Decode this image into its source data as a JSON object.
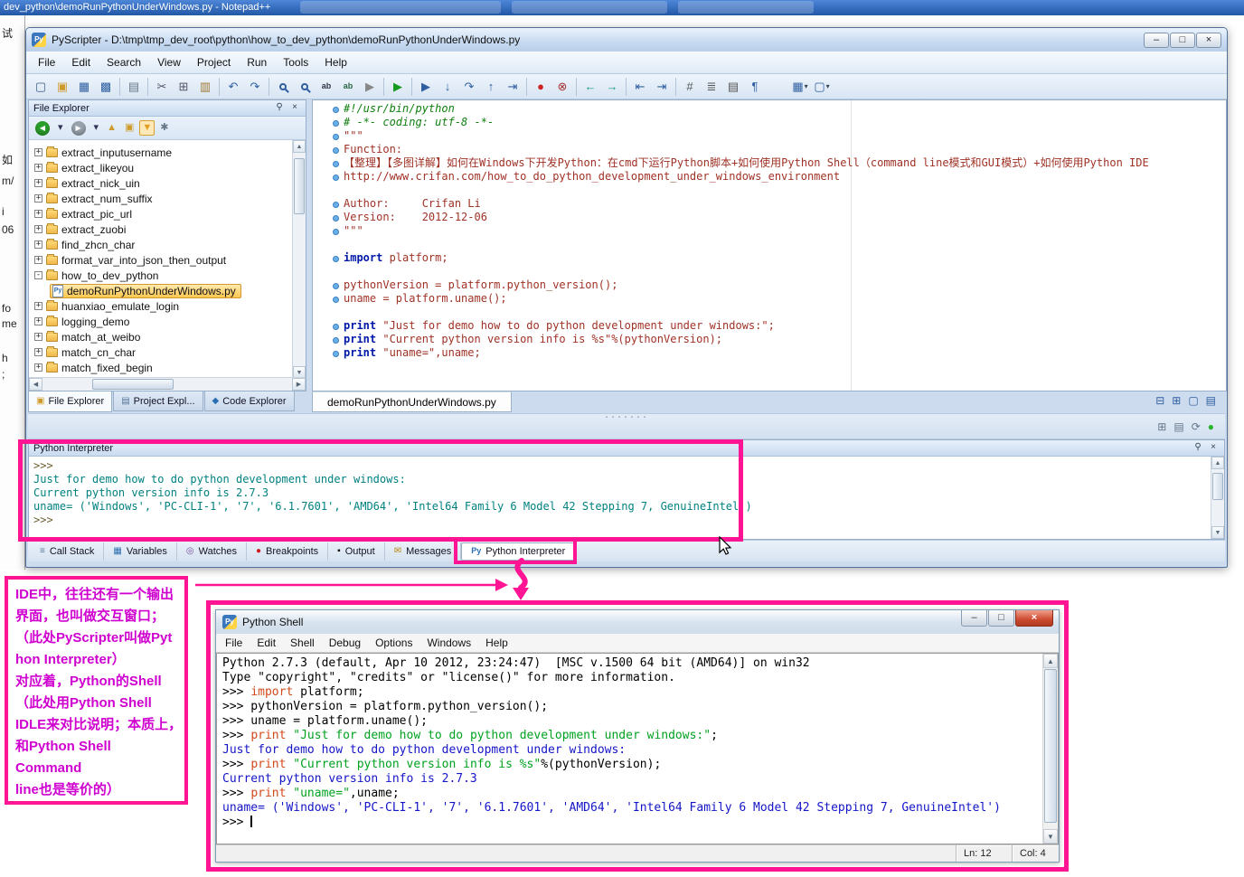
{
  "background": {
    "notepadpp_title": "dev_python\\demoRunPythonUnderWindows.py - Notepad++",
    "left_fragments": [
      "试",
      "如",
      "m/",
      "i",
      "06",
      "fo",
      "me",
      "h",
      ";"
    ]
  },
  "icons": {
    "pin": "⚲",
    "close": "×",
    "minimize": "–",
    "maximize": "□",
    "up": "▲",
    "down": "▼",
    "left": "◀",
    "right": "▶",
    "dropdown": "▾",
    "grip": "·······",
    "pyfile_glyph": "Py",
    "app_glyph": "Py"
  },
  "pyscripter": {
    "title": "PyScripter - D:\\tmp\\tmp_dev_root\\python\\how_to_dev_python\\demoRunPythonUnderWindows.py",
    "menu": [
      "File",
      "Edit",
      "Search",
      "View",
      "Project",
      "Run",
      "Tools",
      "Help"
    ],
    "toolbar": [
      {
        "n": "new-file-icon",
        "g": "▢",
        "c": "#3a5a80"
      },
      {
        "n": "open-file-icon",
        "g": "▣",
        "c": "#cf9a2c"
      },
      {
        "n": "save-icon",
        "g": "▦",
        "c": "#2f5fa0"
      },
      {
        "n": "save-all-icon",
        "g": "▩",
        "c": "#2f5fa0"
      },
      {
        "sep": true
      },
      {
        "n": "print-icon",
        "g": "▤",
        "c": "#667788"
      },
      {
        "sep": true
      },
      {
        "n": "cut-icon",
        "g": "✂",
        "c": "#556"
      },
      {
        "n": "copy-icon",
        "g": "⊞",
        "c": "#556"
      },
      {
        "n": "paste-icon",
        "g": "▥",
        "c": "#a07830"
      },
      {
        "sep": true
      },
      {
        "n": "undo-icon",
        "g": "↶",
        "c": "#2f5fa0"
      },
      {
        "n": "redo-icon",
        "g": "↷",
        "c": "#2f5fa0"
      },
      {
        "sep": true
      },
      {
        "n": "find-icon",
        "mag": true
      },
      {
        "n": "find-next-icon",
        "mag": true
      },
      {
        "n": "find-in-files-icon",
        "g": "ab",
        "c": "#334",
        "small": true
      },
      {
        "n": "replace-icon",
        "g": "ab",
        "c": "#286643",
        "small": true
      },
      {
        "n": "run-script-external-icon",
        "g": "▶",
        "c": "#888"
      },
      {
        "sep": true
      },
      {
        "n": "run-icon",
        "g": "▶",
        "c": "#18991f"
      },
      {
        "sep": true
      },
      {
        "n": "debug-icon",
        "g": "▶",
        "c": "#2f5fa0"
      },
      {
        "n": "step-into-icon",
        "g": "↓",
        "c": "#2f5fa0"
      },
      {
        "n": "step-over-icon",
        "g": "↷",
        "c": "#2f5fa0"
      },
      {
        "n": "step-out-icon",
        "g": "↑",
        "c": "#2f5fa0"
      },
      {
        "n": "run-to-cursor-icon",
        "g": "⇥",
        "c": "#2f5fa0"
      },
      {
        "sep": true
      },
      {
        "n": "stop-icon",
        "g": "●",
        "c": "#cc2222"
      },
      {
        "n": "detach-debugger-icon",
        "g": "⊗",
        "c": "#aa3333"
      },
      {
        "sep": true
      },
      {
        "n": "browse-back-icon",
        "g": "←",
        "c": "#1a9988"
      },
      {
        "n": "browse-forward-icon",
        "g": "→",
        "c": "#1a9988"
      },
      {
        "sep": true
      },
      {
        "n": "unindent-icon",
        "g": "⇤",
        "c": "#2f5fa0"
      },
      {
        "n": "indent-icon",
        "g": "⇥",
        "c": "#2f5fa0"
      },
      {
        "sep": true
      },
      {
        "n": "line-numbers-icon",
        "g": "#",
        "c": "#555"
      },
      {
        "n": "sorted-list-icon",
        "g": "≣",
        "c": "#555"
      },
      {
        "n": "doc-map-icon",
        "g": "▤",
        "c": "#555"
      },
      {
        "n": "special-chars-icon",
        "g": "¶",
        "c": "#2f5fa0"
      },
      {
        "gap": true
      },
      {
        "n": "editor-views-icon",
        "g": "▦",
        "c": "#2f5fa0",
        "dd": true
      },
      {
        "n": "layouts-icon",
        "g": "▢",
        "c": "#2f5fa0",
        "dd": true
      }
    ],
    "file_explorer": {
      "header": "File Explorer",
      "toolbar": [
        {
          "n": "back-icon",
          "g": "◀",
          "circle": "#2ba02b"
        },
        {
          "n": "back-history-dropdown",
          "g": "▾",
          "c": "#335"
        },
        {
          "n": "forward-icon",
          "g": "▶",
          "circle": "#9aa4ae"
        },
        {
          "n": "forward-history-dropdown",
          "g": "▾",
          "c": "#335"
        },
        {
          "n": "folder-up-icon",
          "g": "▲",
          "c": "#cf9a2c"
        },
        {
          "n": "new-folder-icon",
          "g": "▣",
          "c": "#cf9a2c"
        },
        {
          "n": "filter-icon",
          "g": "▼",
          "c": "#e0a020",
          "active": true
        },
        {
          "n": "folder-settings-icon",
          "g": "✱",
          "c": "#667788"
        }
      ],
      "tree": [
        {
          "label": "extract_inputusername",
          "expand": "+",
          "icon": "folder",
          "indent": 0
        },
        {
          "label": "extract_likeyou",
          "expand": "+",
          "icon": "folder",
          "indent": 0
        },
        {
          "label": "extract_nick_uin",
          "expand": "+",
          "icon": "folder",
          "indent": 0
        },
        {
          "label": "extract_num_suffix",
          "expand": "+",
          "icon": "folder",
          "indent": 0
        },
        {
          "label": "extract_pic_url",
          "expand": "+",
          "icon": "folder",
          "indent": 0
        },
        {
          "label": "extract_zuobi",
          "expand": "+",
          "icon": "folder",
          "indent": 0
        },
        {
          "label": "find_zhcn_char",
          "expand": "+",
          "icon": "folder",
          "indent": 0
        },
        {
          "label": "format_var_into_json_then_output",
          "expand": "+",
          "icon": "folder",
          "indent": 0
        },
        {
          "label": "how_to_dev_python",
          "expand": "-",
          "icon": "folder",
          "indent": 0
        },
        {
          "label": "demoRunPythonUnderWindows.py",
          "expand": "",
          "icon": "pyfile",
          "indent": 1,
          "selected": true
        },
        {
          "label": "huanxiao_emulate_login",
          "expand": "+",
          "icon": "folder",
          "indent": 0
        },
        {
          "label": "logging_demo",
          "expand": "+",
          "icon": "folder",
          "indent": 0
        },
        {
          "label": "match_at_weibo",
          "expand": "+",
          "icon": "folder",
          "indent": 0
        },
        {
          "label": "match_cn_char",
          "expand": "+",
          "icon": "folder",
          "indent": 0
        },
        {
          "label": "match_fixed_begin",
          "expand": "+",
          "icon": "folder",
          "indent": 0
        }
      ],
      "dock_tabs": [
        {
          "label": "File Explorer",
          "icon": "file-explorer-tab-icon",
          "g": "▣",
          "gc": "#cf9a2c",
          "active": true
        },
        {
          "label": "Project Expl...",
          "icon": "project-explorer-tab-icon",
          "g": "▤",
          "gc": "#557799"
        },
        {
          "label": "Code Explorer",
          "icon": "code-explorer-tab-icon",
          "g": "◆",
          "gc": "#2b6fb0"
        }
      ]
    },
    "editor": {
      "tab_label": "demoRunPythonUnderWindows.py",
      "lines": [
        [
          {
            "t": "#!/usr/bin/python",
            "c": "cm"
          }
        ],
        [
          {
            "t": "# -*- coding: utf-8 -*-",
            "c": "cm"
          }
        ],
        [
          {
            "t": "\"\"\"",
            "c": "tx"
          }
        ],
        [
          {
            "t": "Function:",
            "c": "tx"
          }
        ],
        [
          {
            "t": "【整理】【多图详解】如何在Windows下开发Python：在cmd下运行Python脚本+如何使用Python Shell（command line模式和GUI模式）+如何使用Python IDE",
            "c": "tx"
          }
        ],
        [
          {
            "t": "http://www.crifan.com/how_to_do_python_development_under_windows_environment",
            "c": "tx"
          }
        ],
        [],
        [
          {
            "t": "Author:     Crifan Li",
            "c": "tx"
          }
        ],
        [
          {
            "t": "Version:    2012-12-06",
            "c": "tx"
          }
        ],
        [
          {
            "t": "\"\"\"",
            "c": "tx"
          }
        ],
        [],
        [
          {
            "t": "import",
            "c": "kw"
          },
          {
            "t": " platform;",
            "c": "tx"
          }
        ],
        [],
        [
          {
            "t": "pythonVersion = platform.python_version();",
            "c": "tx"
          }
        ],
        [
          {
            "t": "uname = platform.uname();",
            "c": "tx"
          }
        ],
        [],
        [
          {
            "t": "print",
            "c": "kw"
          },
          {
            "t": " \"Just for demo how to do python development under windows:\";",
            "c": "tx"
          }
        ],
        [
          {
            "t": "print",
            "c": "kw"
          },
          {
            "t": " \"Current python version info is %s\"%(pythonVersion);",
            "c": "tx"
          }
        ],
        [
          {
            "t": "print",
            "c": "kw"
          },
          {
            "t": " \"uname=\",uname;",
            "c": "tx"
          }
        ]
      ]
    },
    "editor_tab_icons": [
      {
        "n": "tab-list-icon",
        "g": "⊟",
        "c": "#2f5fa0"
      },
      {
        "n": "split-view-icon",
        "g": "⊞",
        "c": "#2f5fa0"
      },
      {
        "n": "new-editor-window-icon",
        "g": "▢",
        "c": "#2f5fa0"
      },
      {
        "n": "float-editor-icon",
        "g": "▤",
        "c": "#2f5fa0"
      }
    ],
    "mid_toolbar_icons": [
      {
        "n": "interpreter-windows-icon",
        "g": "⊞",
        "c": "#667788"
      },
      {
        "n": "interpreter-copy-icon",
        "g": "▤",
        "c": "#667788"
      },
      {
        "n": "interpreter-refresh-icon",
        "g": "⟳",
        "c": "#667788"
      },
      {
        "n": "engine-status-icon",
        "g": "●",
        "c": "#2bb32b"
      }
    ],
    "interpreter": {
      "header": "Python Interpreter",
      "lines": [
        [
          {
            "t": ">>> ",
            "c": "p"
          }
        ],
        [
          {
            "t": "Just for demo how to do python development under windows:",
            "c": "o"
          }
        ],
        [
          {
            "t": "Current python version info is 2.7.3",
            "c": "o"
          }
        ],
        [
          {
            "t": "uname= ('Windows', 'PC-CLI-1', '7', '6.1.7601', 'AMD64', 'Intel64 Family 6 Model 42 Stepping 7, GenuineIntel')",
            "c": "o"
          }
        ],
        [
          {
            "t": ">>> ",
            "c": "p"
          }
        ]
      ]
    },
    "bottom_tabs": [
      {
        "label": "Call Stack",
        "icon": "call-stack-icon",
        "g": "≡",
        "gc": "#557799"
      },
      {
        "label": "Variables",
        "icon": "variables-icon",
        "g": "▦",
        "gc": "#2b6fb0"
      },
      {
        "label": "Watches",
        "icon": "watches-icon",
        "g": "◎",
        "gc": "#7a4f9e"
      },
      {
        "label": "Breakpoints",
        "icon": "breakpoints-icon",
        "g": "●",
        "gc": "#cc2020"
      },
      {
        "label": "Output",
        "icon": "output-icon",
        "g": "▪",
        "gc": "#111111"
      },
      {
        "label": "Messages",
        "icon": "messages-icon",
        "g": "✉",
        "gc": "#b8860b"
      },
      {
        "label": "Python Interpreter",
        "icon": "python-interpreter-icon",
        "g": "Py",
        "gc": "#2b6fb0",
        "active": true
      }
    ]
  },
  "annotation": {
    "lines": [
      "IDE中，往往还有一个输出",
      "界面，也叫做交互窗口；",
      "（此处PyScripter叫做Pyt",
      "hon Interpreter）",
      "对应着，Python的Shell",
      "（此处用Python Shell",
      "IDLE来对比说明；本质上，",
      "和Python Shell",
      "Command",
      "line也是等价的）"
    ]
  },
  "shell": {
    "title": "Python Shell",
    "menu": [
      "File",
      "Edit",
      "Shell",
      "Debug",
      "Options",
      "Windows",
      "Help"
    ],
    "lines": [
      [
        {
          "t": "Python 2.7.3 (default, Apr 10 2012, 23:24:47)  [MSC v.1500 64 bit (AMD64)] on win32",
          "c": "k0"
        }
      ],
      [
        {
          "t": "Type \"copyright\", \"credits\" or \"license()\" for more information.",
          "c": "k0"
        }
      ],
      [
        {
          "t": ">>> ",
          "c": "k0"
        },
        {
          "t": "import",
          "c": "kw"
        },
        {
          "t": " platform;",
          "c": "k0"
        }
      ],
      [
        {
          "t": ">>> pythonVersion = platform.python_version();",
          "c": "k0"
        }
      ],
      [
        {
          "t": ">>> uname = platform.uname();",
          "c": "k0"
        }
      ],
      [
        {
          "t": ">>> ",
          "c": "k0"
        },
        {
          "t": "print",
          "c": "kw"
        },
        {
          "t": " ",
          "c": "k0"
        },
        {
          "t": "\"Just for demo how to do python development under windows:\"",
          "c": "st"
        },
        {
          "t": ";",
          "c": "k0"
        }
      ],
      [
        {
          "t": "Just for demo how to do python development under windows:",
          "c": "ob"
        }
      ],
      [
        {
          "t": ">>> ",
          "c": "k0"
        },
        {
          "t": "print",
          "c": "kw"
        },
        {
          "t": " ",
          "c": "k0"
        },
        {
          "t": "\"Current python version info is %s\"",
          "c": "st"
        },
        {
          "t": "%(pythonVersion);",
          "c": "k0"
        }
      ],
      [
        {
          "t": "Current python version info is 2.7.3",
          "c": "ob"
        }
      ],
      [
        {
          "t": ">>> ",
          "c": "k0"
        },
        {
          "t": "print",
          "c": "kw"
        },
        {
          "t": " ",
          "c": "k0"
        },
        {
          "t": "\"uname=\"",
          "c": "st"
        },
        {
          "t": ",uname;",
          "c": "k0"
        }
      ],
      [
        {
          "t": "uname= ('Windows', 'PC-CLI-1', '7', '6.1.7601', 'AMD64', 'Intel64 Family 6 Model 42 Stepping 7, GenuineIntel')",
          "c": "ob"
        }
      ],
      [
        {
          "t": ">>> ",
          "c": "k0"
        },
        {
          "t": "",
          "c": "cur"
        }
      ]
    ],
    "status_ln": "Ln: 12",
    "status_col": "Col: 4"
  }
}
